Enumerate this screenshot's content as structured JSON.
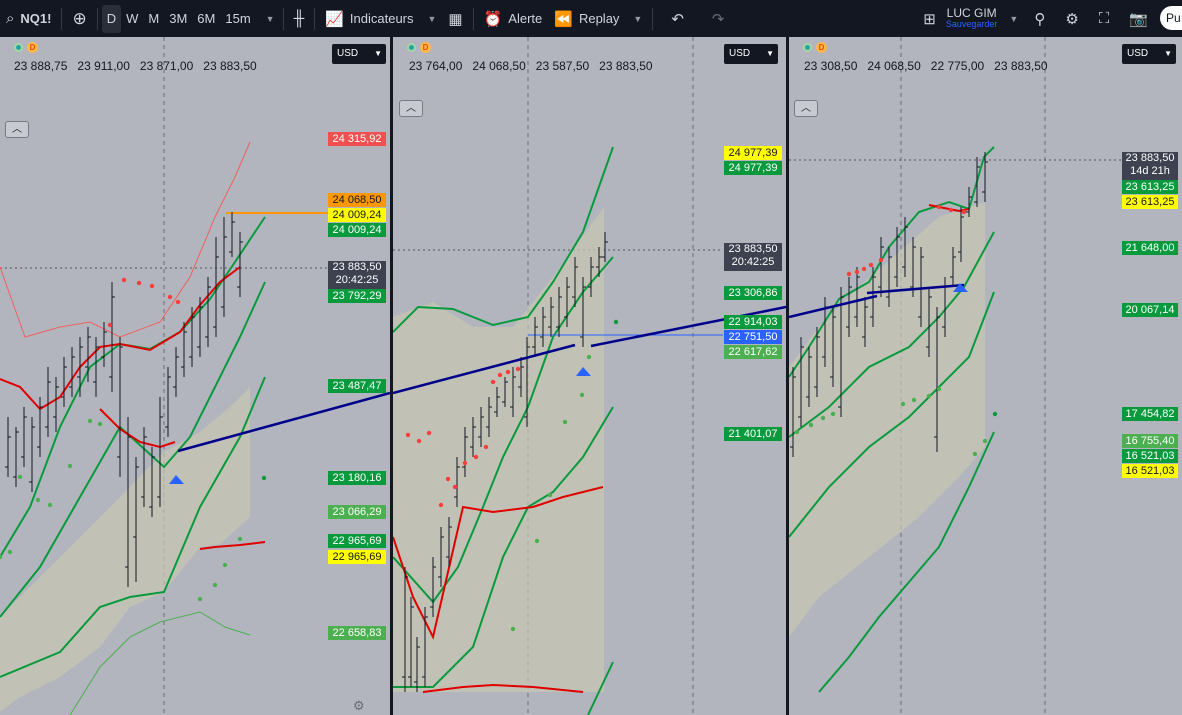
{
  "toolbar": {
    "symbol": "NQ1!",
    "timeframes": [
      "D",
      "W",
      "M",
      "3M",
      "6M",
      "15m"
    ],
    "active_timeframe": "D",
    "indicators_label": "Indicateurs",
    "alert_label": "Alerte",
    "replay_label": "Replay",
    "layout_name": "LUC GIM",
    "layout_status": "Sauvegarder",
    "publish_label": "Pu"
  },
  "panes": [
    {
      "currency": "USD",
      "ohlc": [
        "23 888,75",
        "23 911,00",
        "23 871,00",
        "23 883,50"
      ],
      "labels": [
        {
          "text": "24 315,92",
          "style": "red"
        },
        {
          "text": "24 068,50",
          "style": "orange"
        },
        {
          "text": "24 009,24",
          "style": "yellow"
        },
        {
          "text": "24 009,24",
          "style": "green"
        },
        {
          "text": "23 883,50",
          "sub": "20:42:25",
          "style": "dark"
        },
        {
          "text": "23 792,29",
          "style": "green"
        },
        {
          "text": "23 487,47",
          "style": "green"
        },
        {
          "text": "23 180,16",
          "style": "green"
        },
        {
          "text": "23 066,29",
          "style": "lgreen"
        },
        {
          "text": "22 965,69",
          "style": "green"
        },
        {
          "text": "22 965,69",
          "style": "yellow"
        },
        {
          "text": "22 658,83",
          "style": "lgreen"
        }
      ]
    },
    {
      "currency": "USD",
      "ohlc": [
        "23 764,00",
        "24 068,50",
        "23 587,50",
        "23 883,50"
      ],
      "labels": [
        {
          "text": "24 977,39",
          "style": "yellow"
        },
        {
          "text": "24 977,39",
          "style": "green"
        },
        {
          "text": "23 883,50",
          "sub": "20:42:25",
          "style": "dark"
        },
        {
          "text": "23 306,86",
          "style": "green"
        },
        {
          "text": "22 914,03",
          "style": "green"
        },
        {
          "text": "22 751,50",
          "style": "blue"
        },
        {
          "text": "22 617,62",
          "style": "lgreen"
        },
        {
          "text": "21 401,07",
          "style": "green"
        }
      ]
    },
    {
      "currency": "USD",
      "ohlc": [
        "23 308,50",
        "24 068,50",
        "22 775,00",
        "23 883,50"
      ],
      "labels": [
        {
          "text": "23 883,50",
          "sub": "14d 21h",
          "style": "dark"
        },
        {
          "text": "23 613,25",
          "style": "green"
        },
        {
          "text": "23 613,25",
          "style": "yellow"
        },
        {
          "text": "21 648,00",
          "style": "green"
        },
        {
          "text": "20 067,14",
          "style": "green"
        },
        {
          "text": "17 454,82",
          "style": "green"
        },
        {
          "text": "16 755,40",
          "style": "lgreen"
        },
        {
          "text": "16 521,03",
          "style": "green"
        },
        {
          "text": "16 521,03",
          "style": "yellow"
        }
      ]
    }
  ]
}
